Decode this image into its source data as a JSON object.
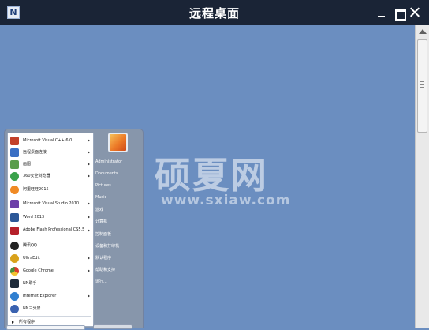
{
  "window": {
    "title": "远程桌面",
    "app_icon_letter": "N"
  },
  "colors": {
    "desktop": "#6b8ec0",
    "titlebar": "#1a2436",
    "start_menu": "#8796ab"
  },
  "watermark": {
    "main": "硕夏网",
    "url": "www.sxiaw.com"
  },
  "start_menu": {
    "programs": [
      {
        "label": "Microsoft Visual C++ 6.0",
        "icon": "vc-icon",
        "color": "#c2402a",
        "arrow": true
      },
      {
        "label": "远程桌面连接",
        "icon": "remote-desktop-icon",
        "color": "#3a6fc4",
        "arrow": true
      },
      {
        "label": "画图",
        "icon": "paint-icon",
        "color": "#5a9d4a",
        "arrow": true
      },
      {
        "label": "360安全浏览器",
        "icon": "360-browser-icon",
        "color": "#3aa24a",
        "arrow": true
      },
      {
        "label": "阿里旺旺2015",
        "icon": "aliwangwang-icon",
        "color": "#f08a24",
        "arrow": false
      },
      {
        "label": "Microsoft Visual Studio 2010",
        "icon": "visual-studio-icon",
        "color": "#6c3fa8",
        "arrow": true
      },
      {
        "label": "Word 2013",
        "icon": "word-icon",
        "color": "#2b5797",
        "arrow": true
      },
      {
        "label": "Adobe Flash Professional CS5.5",
        "icon": "flash-icon",
        "color": "#b5202a",
        "arrow": true
      },
      {
        "label": "腾讯QQ",
        "icon": "qq-icon",
        "color": "#222222",
        "arrow": false
      },
      {
        "label": "UltraEdit",
        "icon": "ultraedit-icon",
        "color": "#d9a21b",
        "arrow": true
      },
      {
        "label": "Google Chrome",
        "icon": "chrome-icon",
        "color": "#4a8f3c",
        "arrow": true
      },
      {
        "label": "NN助手",
        "icon": "nn-icon",
        "color": "#1d2a3a",
        "arrow": false
      },
      {
        "label": "Internet Explorer",
        "icon": "ie-icon",
        "color": "#2f7fd0",
        "arrow": true
      },
      {
        "label": "NN三分屏",
        "icon": "nn-split-icon",
        "color": "#3a62b0",
        "arrow": false
      }
    ],
    "all_programs": "所有程序",
    "places": [
      "Administrator",
      "Documents",
      "Pictures",
      "Music",
      "游戏",
      "计算机",
      "控制面板",
      "设备和打印机",
      "默认程序",
      "帮助和支持",
      "运行..."
    ]
  }
}
